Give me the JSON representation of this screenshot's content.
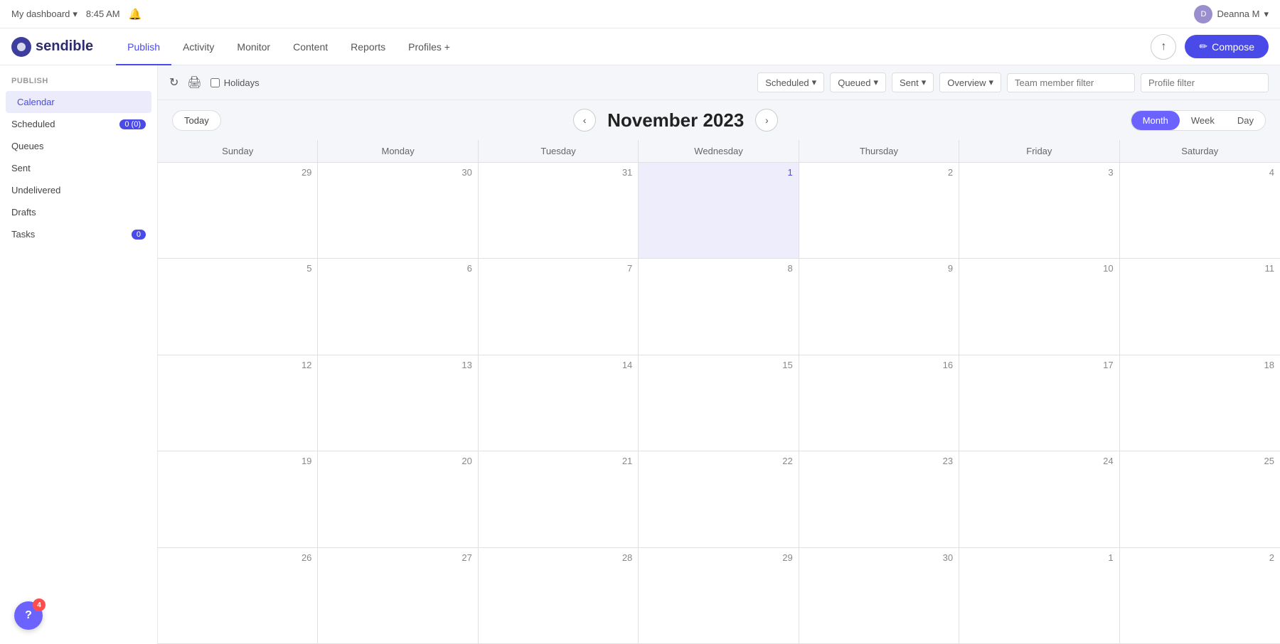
{
  "topBar": {
    "dashboard": "My dashboard",
    "time": "8:45 AM",
    "user": "Deanna M",
    "dropdown_icon": "▾"
  },
  "nav": {
    "logo": "sendible",
    "tabs": [
      {
        "label": "Publish",
        "active": true
      },
      {
        "label": "Activity",
        "active": false
      },
      {
        "label": "Monitor",
        "active": false
      },
      {
        "label": "Content",
        "active": false
      },
      {
        "label": "Reports",
        "active": false
      },
      {
        "label": "Profiles +",
        "active": false
      }
    ],
    "compose_label": "✏ Compose"
  },
  "sidebar": {
    "section_label": "PUBLISH",
    "items": [
      {
        "label": "Calendar",
        "active": true,
        "badge": null
      },
      {
        "label": "Scheduled",
        "active": false,
        "badge": "0 (0)"
      },
      {
        "label": "Queues",
        "active": false,
        "badge": null
      },
      {
        "label": "Sent",
        "active": false,
        "badge": null
      },
      {
        "label": "Undelivered",
        "active": false,
        "badge": null
      },
      {
        "label": "Drafts",
        "active": false,
        "badge": null
      },
      {
        "label": "Tasks",
        "active": false,
        "badge": "0"
      }
    ]
  },
  "toolbar": {
    "holidays_label": "Holidays",
    "filters": [
      {
        "label": "Scheduled",
        "dropdown": true
      },
      {
        "label": "Queued",
        "dropdown": true
      },
      {
        "label": "Sent",
        "dropdown": true
      },
      {
        "label": "Overview",
        "dropdown": true
      }
    ],
    "team_filter_placeholder": "Team member filter",
    "profile_filter_placeholder": "Profile filter"
  },
  "calendar": {
    "today_label": "Today",
    "month_title": "November 2023",
    "view_buttons": [
      {
        "label": "Month",
        "active": true
      },
      {
        "label": "Week",
        "active": false
      },
      {
        "label": "Day",
        "active": false
      }
    ],
    "day_headers": [
      "Sunday",
      "Monday",
      "Tuesday",
      "Wednesday",
      "Thursday",
      "Friday",
      "Saturday"
    ],
    "weeks": [
      [
        {
          "day": "29",
          "other": true,
          "today": false
        },
        {
          "day": "30",
          "other": true,
          "today": false
        },
        {
          "day": "31",
          "other": true,
          "today": false
        },
        {
          "day": "1",
          "other": false,
          "today": true
        },
        {
          "day": "2",
          "other": false,
          "today": false
        },
        {
          "day": "3",
          "other": false,
          "today": false
        },
        {
          "day": "4",
          "other": false,
          "today": false
        }
      ],
      [
        {
          "day": "5",
          "other": false,
          "today": false
        },
        {
          "day": "6",
          "other": false,
          "today": false
        },
        {
          "day": "7",
          "other": false,
          "today": false
        },
        {
          "day": "8",
          "other": false,
          "today": false
        },
        {
          "day": "9",
          "other": false,
          "today": false
        },
        {
          "day": "10",
          "other": false,
          "today": false
        },
        {
          "day": "11",
          "other": false,
          "today": false
        }
      ],
      [
        {
          "day": "12",
          "other": false,
          "today": false
        },
        {
          "day": "13",
          "other": false,
          "today": false
        },
        {
          "day": "14",
          "other": false,
          "today": false
        },
        {
          "day": "15",
          "other": false,
          "today": false
        },
        {
          "day": "16",
          "other": false,
          "today": false
        },
        {
          "day": "17",
          "other": false,
          "today": false
        },
        {
          "day": "18",
          "other": false,
          "today": false
        }
      ],
      [
        {
          "day": "19",
          "other": false,
          "today": false
        },
        {
          "day": "20",
          "other": false,
          "today": false
        },
        {
          "day": "21",
          "other": false,
          "today": false
        },
        {
          "day": "22",
          "other": false,
          "today": false
        },
        {
          "day": "23",
          "other": false,
          "today": false
        },
        {
          "day": "24",
          "other": false,
          "today": false
        },
        {
          "day": "25",
          "other": false,
          "today": false
        }
      ],
      [
        {
          "day": "26",
          "other": false,
          "today": false
        },
        {
          "day": "27",
          "other": false,
          "today": false
        },
        {
          "day": "28",
          "other": false,
          "today": false
        },
        {
          "day": "29",
          "other": false,
          "today": false
        },
        {
          "day": "30",
          "other": false,
          "today": false
        },
        {
          "day": "1",
          "other": true,
          "today": false
        },
        {
          "day": "2",
          "other": true,
          "today": false
        }
      ]
    ]
  },
  "help": {
    "icon": "?",
    "badge": "4"
  }
}
